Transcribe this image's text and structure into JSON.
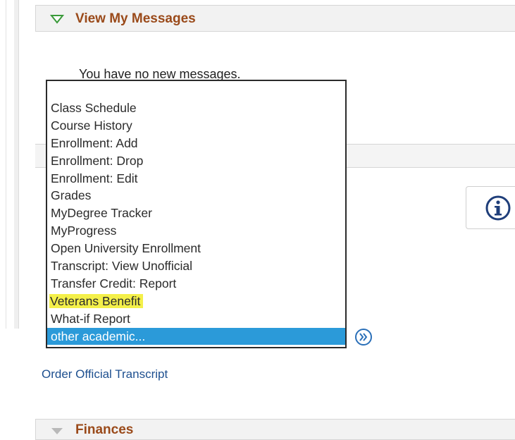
{
  "messages_panel": {
    "title": "View My Messages",
    "empty_text": "You have no new messages."
  },
  "academics_dropdown": {
    "options": [
      "Class Schedule",
      "Course History",
      "Enrollment: Add",
      "Enrollment: Drop",
      "Enrollment: Edit",
      "Grades",
      "MyDegree Tracker",
      "MyProgress",
      "Open University Enrollment",
      "Transcript: View Unofficial",
      "Transfer Credit: Report",
      "Veterans Benefit",
      "What-if Report",
      "other academic..."
    ],
    "selected": "other academic...",
    "highlighted": "Veterans Benefit"
  },
  "links": {
    "order_transcript": "Order Official Transcript"
  },
  "finances_panel": {
    "title": "Finances"
  },
  "colors": {
    "header_title": "#9a4a1a",
    "expanded_triangle": "#3a9a3a",
    "collapsed_triangle": "#b9b9b9",
    "selected_option": "#2b9ad9",
    "highlight": "#f4f04a",
    "link": "#1d4f8f"
  },
  "icons": {
    "expanded": "triangle-down-green-icon",
    "collapsed": "triangle-down-gray-icon",
    "info": "info-icon",
    "go": "double-chevron-right-icon"
  }
}
